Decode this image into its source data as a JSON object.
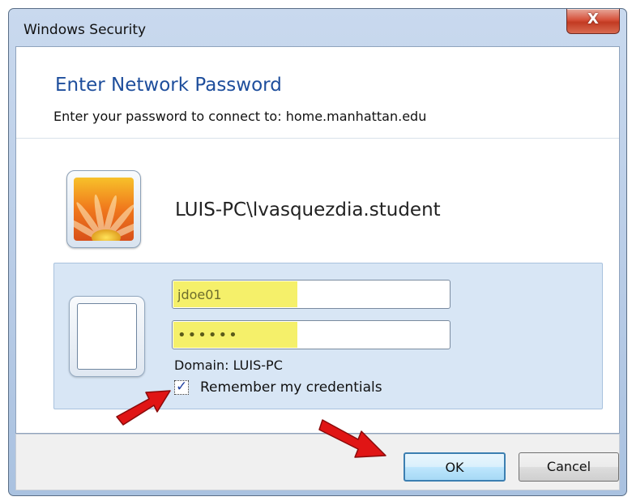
{
  "window": {
    "title": "Windows Security",
    "close_glyph": "X"
  },
  "dialog": {
    "heading": "Enter Network Password",
    "subheading": "Enter your password to connect to: home.manhattan.edu",
    "account_name": "LUIS-PC\\lvasquezdia.student",
    "username_value": "jdoe01",
    "password_value": "••••••",
    "domain_text": "Domain: LUIS-PC",
    "remember_label": "Remember my credentials",
    "remember_checked": true
  },
  "buttons": {
    "ok_label": "OK",
    "cancel_label": "Cancel"
  },
  "colors": {
    "heading": "#1e4e9c",
    "highlight": "#f5f06a",
    "annotation_arrow": "#e01515"
  },
  "icons": {
    "user_tile": "flower-user-picture",
    "blank_tile": "blank-credential-tile",
    "annotation": "red-arrow-icon"
  }
}
